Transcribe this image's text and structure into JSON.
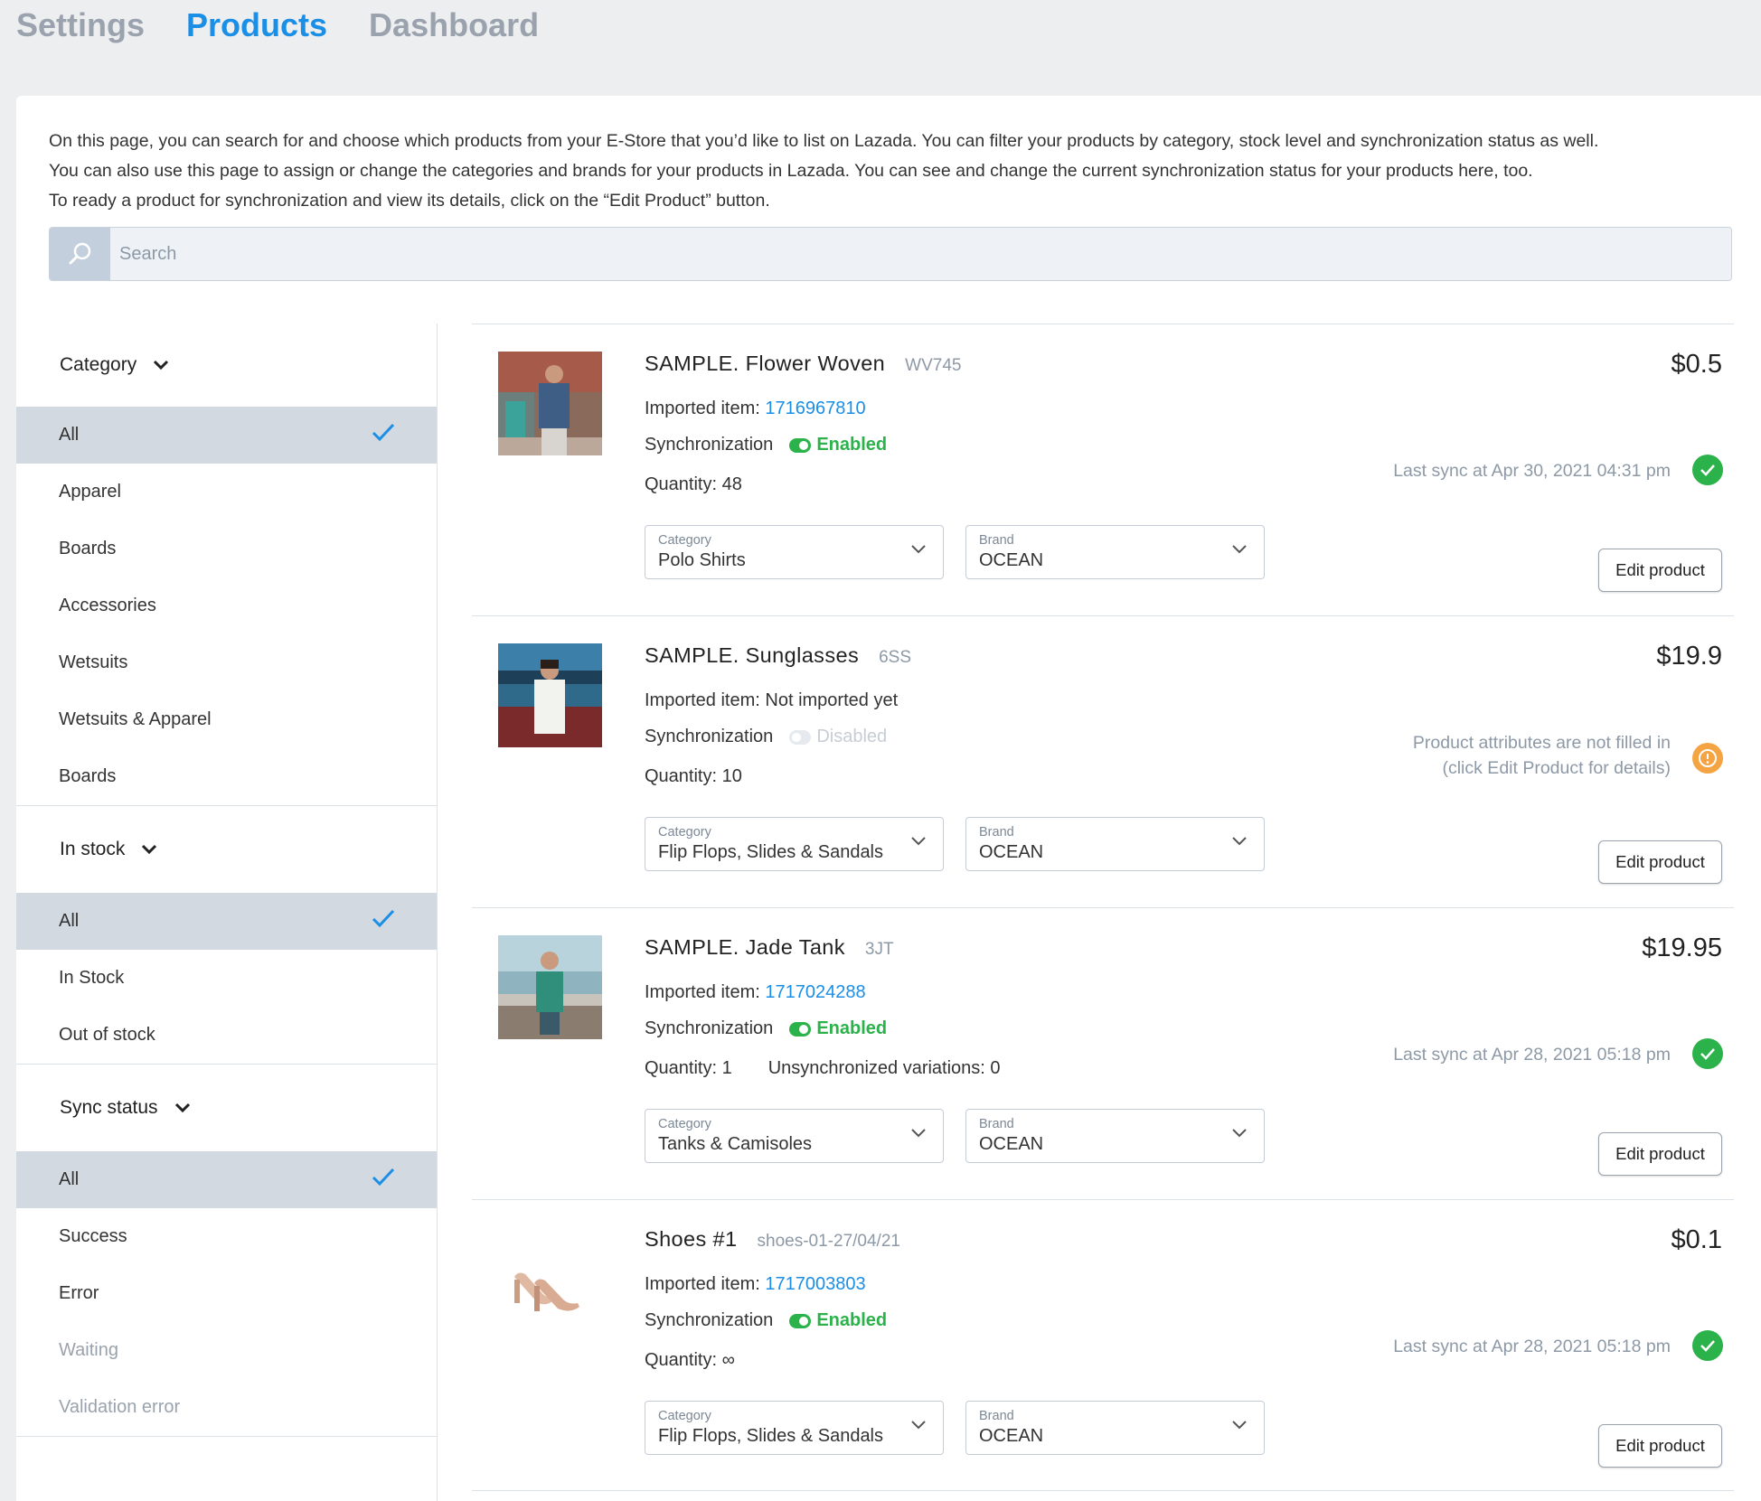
{
  "tabs": [
    {
      "label": "Settings"
    },
    {
      "label": "Products"
    },
    {
      "label": "Dashboard"
    }
  ],
  "intro": {
    "line1": "On this page, you can search for and choose which products from your E-Store that you’d like to list on Lazada. You can filter your products by category, stock level and synchronization status as well.",
    "line2": "You can also use this page to assign or change the categories and brands for your products in Lazada. You can see and change the current synchronization status for your products here, too.",
    "line3": "To ready a product for synchronization and view its details, click on the “Edit Product” button."
  },
  "search": {
    "placeholder": "Search",
    "value": ""
  },
  "filters": {
    "category": {
      "title": "Category",
      "items": [
        "All",
        "Apparel",
        "Boards",
        "Accessories",
        "Wetsuits",
        "Wetsuits & Apparel",
        "Boards"
      ],
      "selected": "All"
    },
    "stock": {
      "title": "In stock",
      "items": [
        "All",
        "In Stock",
        "Out of stock"
      ],
      "selected": "All"
    },
    "sync": {
      "title": "Sync status",
      "items": [
        "All",
        "Success",
        "Error",
        "Waiting",
        "Validation error"
      ],
      "selected": "All"
    }
  },
  "labels": {
    "imported": "Imported item: ",
    "synchronization": "Synchronization",
    "quantity": "Quantity: ",
    "category": "Category",
    "brand": "Brand",
    "edit": "Edit product",
    "unsync": "Unsynchronized variations: 0"
  },
  "products": [
    {
      "name": "SAMPLE. Flower Woven",
      "sku": "WV745",
      "price": "$0.5",
      "imported_id": "1716967810",
      "sync": "Enabled",
      "quantity": "48",
      "category": "Polo Shirts",
      "brand": "OCEAN",
      "status": "Last sync at Apr 30, 2021 04:31 pm"
    },
    {
      "name": "SAMPLE. Sunglasses",
      "sku": "6SS",
      "price": "$19.9",
      "imported_text": "Not imported yet",
      "sync": "Disabled",
      "quantity": "10",
      "category": "Flip Flops, Slides & Sandals",
      "brand": "OCEAN",
      "status_line1": "Product attributes are not filled in",
      "status_line2": "(click Edit Product for details)"
    },
    {
      "name": "SAMPLE. Jade Tank",
      "sku": "3JT",
      "price": "$19.95",
      "imported_id": "1717024288",
      "sync": "Enabled",
      "quantity": "1",
      "category": "Tanks & Camisoles",
      "brand": "OCEAN",
      "status": "Last sync at Apr 28, 2021 05:18 pm"
    },
    {
      "name": "Shoes #1",
      "sku": "shoes-01-27/04/21",
      "price": "$0.1",
      "imported_id": "1717003803",
      "sync": "Enabled",
      "quantity": "∞",
      "category": "Flip Flops, Slides & Sandals",
      "brand": "OCEAN",
      "status": "Last sync at Apr 28, 2021 05:18 pm"
    }
  ],
  "colors": {
    "accent": "#1b8ee6",
    "success": "#2bb24a",
    "warning": "#f4a442",
    "selected_bg": "#d3d9e1"
  }
}
